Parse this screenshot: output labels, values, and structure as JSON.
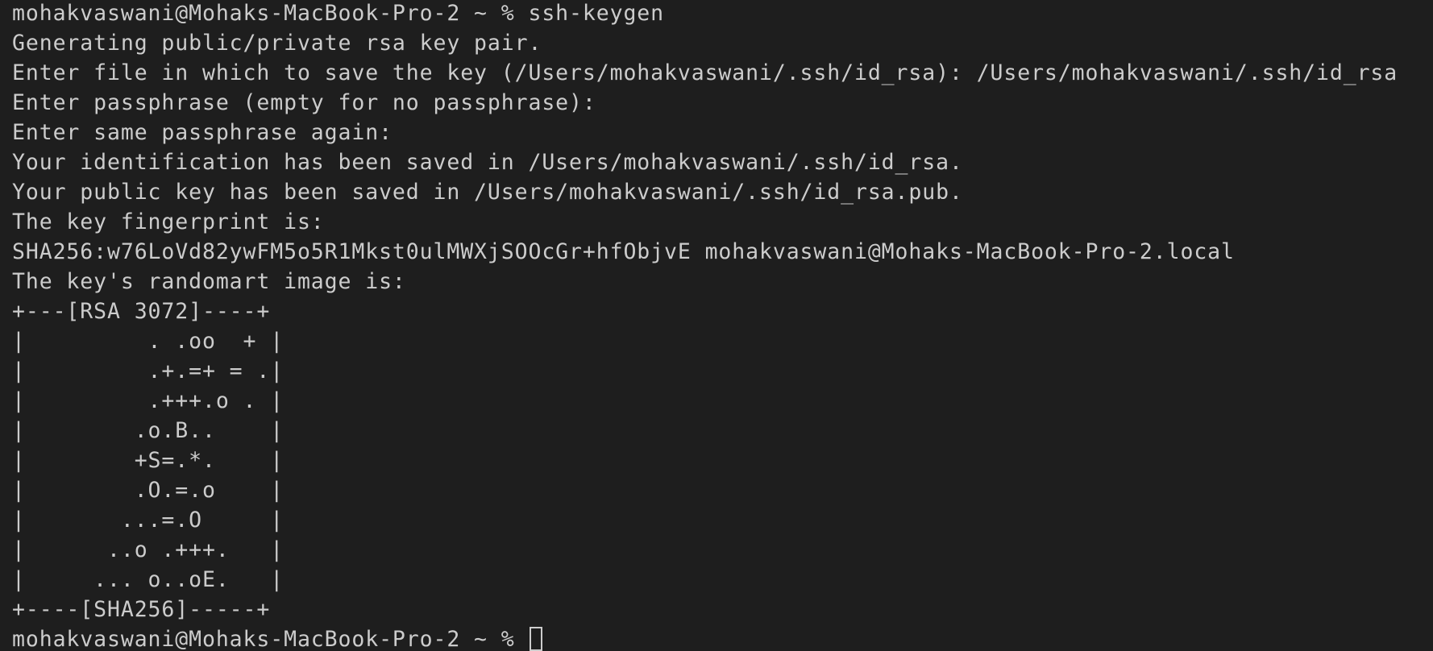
{
  "terminal": {
    "prompt": "mohakvaswani@Mohaks-MacBook-Pro-2 ~ % ",
    "command": "ssh-keygen",
    "output": [
      "Generating public/private rsa key pair.",
      "Enter file in which to save the key (/Users/mohakvaswani/.ssh/id_rsa): /Users/mohakvaswani/.ssh/id_rsa",
      "Enter passphrase (empty for no passphrase):",
      "Enter same passphrase again:",
      "Your identification has been saved in /Users/mohakvaswani/.ssh/id_rsa.",
      "Your public key has been saved in /Users/mohakvaswani/.ssh/id_rsa.pub.",
      "The key fingerprint is:",
      "SHA256:w76LoVd82ywFM5o5R1Mkst0ulMWXjSOOcGr+hfObjvE mohakvaswani@Mohaks-MacBook-Pro-2.local",
      "The key's randomart image is:",
      "+---[RSA 3072]----+",
      "|         . .oo  + |",
      "|         .+.=+ = .|",
      "|         .+++.o . |",
      "|        .o.B..    |",
      "|        +S=.*.    |",
      "|        .O.=.o    |",
      "|       ...=.O     |",
      "|      ..o .+++.   |",
      "|     ... o..oE.   |",
      "+----[SHA256]-----+"
    ],
    "final_prompt": "mohakvaswani@Mohaks-MacBook-Pro-2 ~ % ",
    "colors": {
      "background": "#1e1e1e",
      "foreground": "#cccccc"
    }
  }
}
